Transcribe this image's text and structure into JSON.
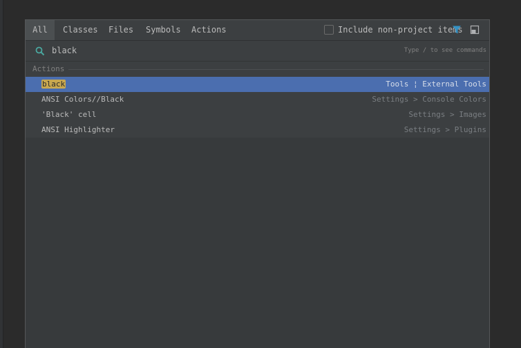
{
  "tabs": [
    {
      "label": "All",
      "active": true
    },
    {
      "label": "Classes",
      "active": false
    },
    {
      "label": "Files",
      "active": false
    },
    {
      "label": "Symbols",
      "active": false
    },
    {
      "label": "Actions",
      "active": false
    }
  ],
  "filter": {
    "label": "Include non-project items",
    "checked": false
  },
  "toolbar_icons": [
    "funnel-icon",
    "pin-window-icon"
  ],
  "search": {
    "value": "black",
    "hint": "Type / to see commands"
  },
  "section": {
    "title": "Actions"
  },
  "results": [
    {
      "highlight": "black",
      "name": "",
      "path": "Tools ¦ External Tools",
      "selected": true
    },
    {
      "highlight": "",
      "name": "ANSI Colors//Black",
      "path": "Settings > Console Colors",
      "selected": false
    },
    {
      "highlight": "",
      "name": "'Black' cell",
      "path": "Settings > Images",
      "selected": false
    },
    {
      "highlight": "",
      "name": "ANSI Highlighter",
      "path": "Settings > Plugins",
      "selected": false
    }
  ],
  "colors": {
    "selection": "#4b6eaf",
    "match_highlight": "#c9a84f",
    "accent_icon": "#3592c4",
    "search_icon": "#4aa8a0"
  }
}
